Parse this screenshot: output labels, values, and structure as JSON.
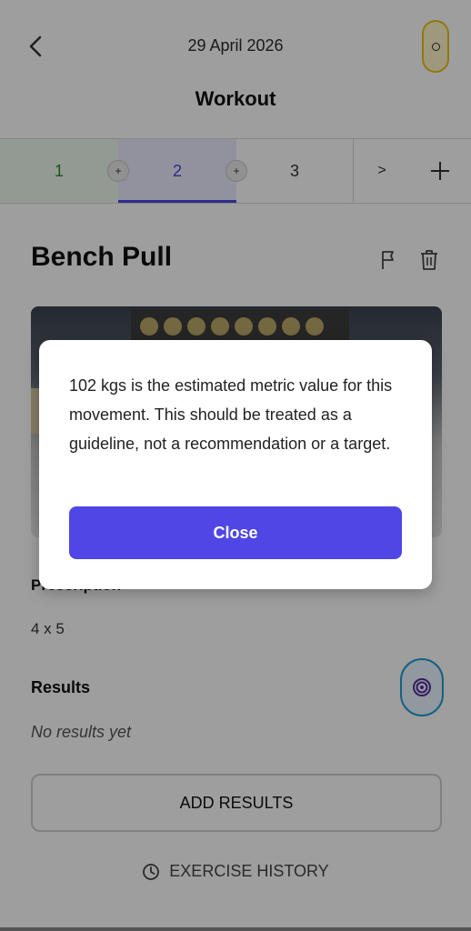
{
  "header": {
    "date": "29 April 2026",
    "title": "Workout",
    "timer_color": "#e8c21a"
  },
  "tabs": [
    {
      "label": "1",
      "state": "completed",
      "color": "#2a8a2a"
    },
    {
      "label": "2",
      "state": "active",
      "color": "#4c46e0"
    },
    {
      "label": "3",
      "state": "upcoming",
      "color": "#333333"
    }
  ],
  "tab_controls": {
    "insert_label": "+",
    "next_label": ">",
    "add_label": "+"
  },
  "exercise": {
    "name": "Bench Pull",
    "prescription_label": "Prescription",
    "prescription_value": "4 x 5",
    "results_label": "Results",
    "results_empty": "No results yet",
    "add_results_label": "ADD RESULTS",
    "history_label": "EXERCISE HISTORY"
  },
  "dialog": {
    "message": "102 kgs is the estimated metric value for this movement. This should be treated as a guideline, not a recommendation or a target.",
    "close_label": "Close",
    "accent": "#4f46e5"
  },
  "icons": [
    "back-arrow-icon",
    "timer-icon",
    "flag-icon",
    "trash-icon",
    "target-icon",
    "clock-icon",
    "plus-icon"
  ]
}
